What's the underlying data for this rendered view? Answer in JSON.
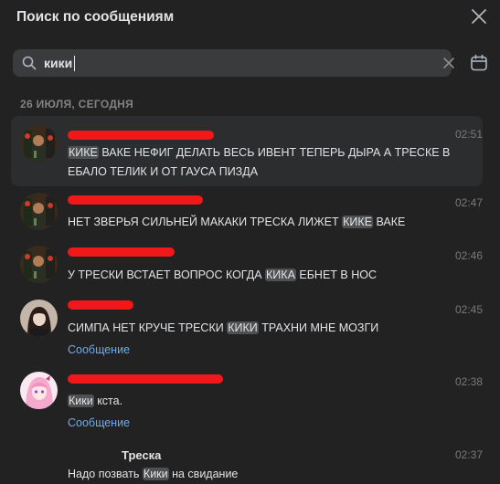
{
  "header": {
    "title": "Поиск по сообщениям"
  },
  "search": {
    "value": "кики",
    "placeholder": ""
  },
  "section": {
    "date_label": "26 ИЮЛЯ, СЕГОДНЯ"
  },
  "results": [
    {
      "time": "02:51",
      "before": "",
      "hl": "КИКЕ",
      "after": " ВАКЕ НЕФИГ ДЕЛАТЬ ВЕСЬ ИВЕНТ ТЕПЕРЬ ДЫРА А ТРЕСКЕ В\nЕБАЛО ТЕЛИК И ОТ ГАУСА ПИЗДА"
    },
    {
      "time": "02:47",
      "before": "НЕТ ЗВЕРЬЯ СИЛЬНЕЙ МАКАКИ ТРЕСКА ЛИЖЕТ ",
      "hl": "КИКЕ",
      "after": " ВАКЕ"
    },
    {
      "time": "02:46",
      "before": "У ТРЕСКИ ВСТАЕТ ВОПРОС КОГДА ",
      "hl": "КИКА",
      "after": " ЕБНЕТ В НОС"
    },
    {
      "time": "02:45",
      "before": "СИМПА НЕТ КРУЧЕ ТРЕСКИ ",
      "hl": "КИКИ",
      "after": " ТРАХНИ МНЕ МОЗГИ",
      "attachment": "Сообщение"
    },
    {
      "time": "02:38",
      "before": "",
      "hl": "Кики",
      "after": " кста.",
      "attachment": "Сообщение"
    },
    {
      "time": "02:37",
      "name": "Треска",
      "before": "Надо позвать ",
      "hl": "Кики",
      "after": " на свидание"
    }
  ],
  "colors": {
    "accent": "#71aaeb",
    "redaction": "#f01818",
    "highlight": "#4f5052",
    "background": "#222222"
  },
  "icons": {
    "close": "close-icon",
    "search": "search-icon",
    "clear": "clear-icon",
    "calendar": "calendar-icon"
  }
}
